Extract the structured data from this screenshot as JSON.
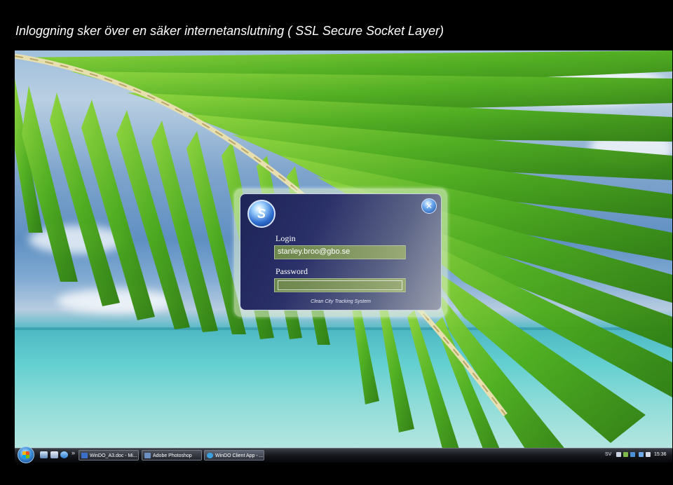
{
  "slide": {
    "title": "Inloggning sker över en säker internetanslutning ( SSL Secure Socket Layer)"
  },
  "login": {
    "logo_icon": "app-logo-orb",
    "logo_text": "S",
    "close_icon": "close-orb-icon",
    "close_glyph": "✕",
    "login_label": "Login",
    "login_value": "stanley.broo@gbo.se",
    "password_label": "Password",
    "password_value": "",
    "footer": "Clean City Tracking System"
  },
  "taskbar": {
    "start_icon": "windows-start-orb",
    "quick_launch_more": "»",
    "buttons": [
      {
        "label": "WinDO_A3.doc - Mi...",
        "icon": "word-icon",
        "color": "#3c6fc8"
      },
      {
        "label": "Adobe Photoshop",
        "icon": "photoshop-icon",
        "color": "#6a8fc0"
      },
      {
        "label": "WinDO Client App - ...",
        "icon": "ie-icon",
        "color": "#3aa0e0"
      }
    ],
    "tray": {
      "language": "SV",
      "clock": "15:36"
    }
  }
}
